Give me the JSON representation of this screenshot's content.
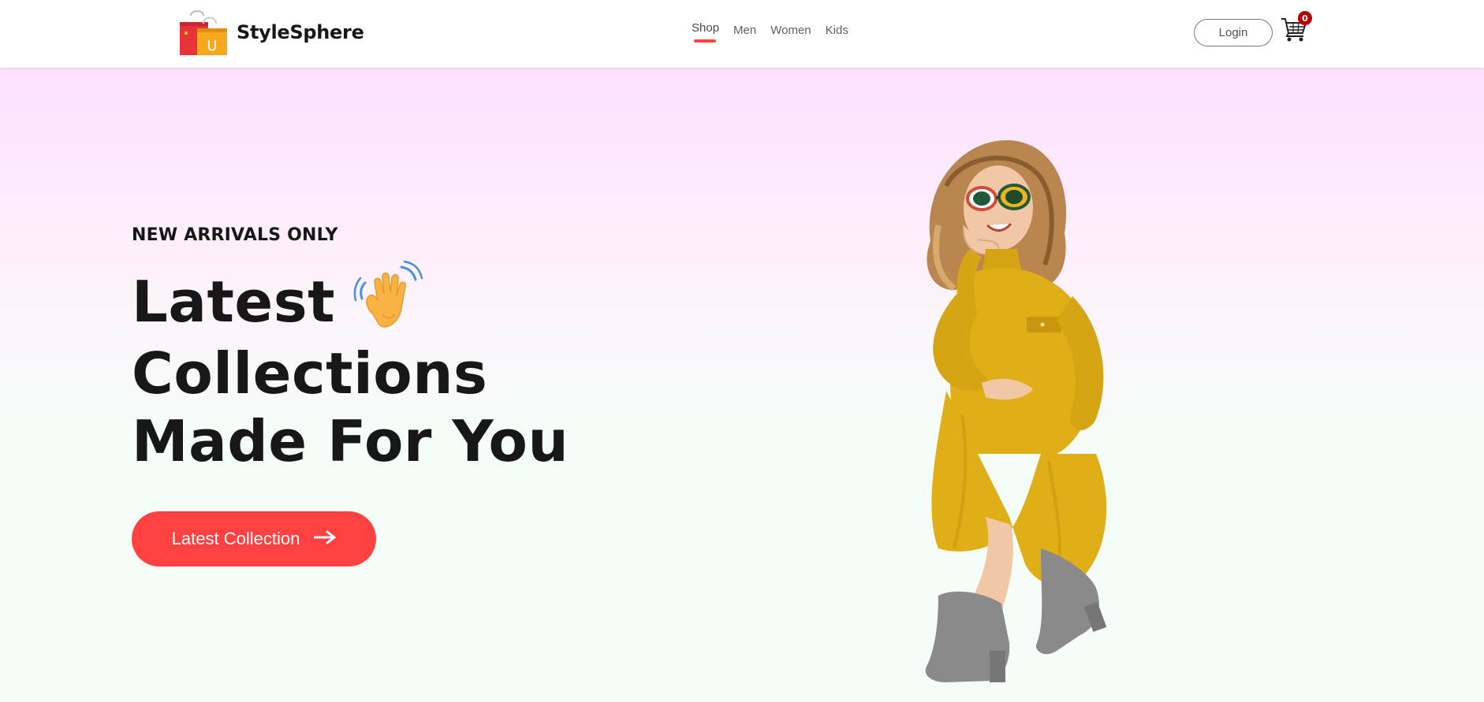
{
  "colors": {
    "accent": "#ff4141",
    "text_dark": "#171717",
    "nav_text": "#626262",
    "cart_badge": "#b80000",
    "hero_gradient_top": "#fde1ff",
    "hero_gradient_bottom": "#f6fdf9"
  },
  "navbar": {
    "brand_name": "StyleSphere",
    "logo_icon": "shopping-bag-icon",
    "menu": [
      {
        "label": "Shop",
        "active": true
      },
      {
        "label": "Men",
        "active": false
      },
      {
        "label": "Women",
        "active": false
      },
      {
        "label": "Kids",
        "active": false
      }
    ],
    "login_label": "Login",
    "cart_icon": "cart-icon",
    "cart_count": "0"
  },
  "hero": {
    "kicker": "NEW ARRIVALS ONLY",
    "headline_line1": "Latest",
    "headline_line2": "Collections",
    "headline_line3": "Made For You",
    "hero_emoji_icon": "waving-hand-icon",
    "cta_label": "Latest Collection",
    "cta_icon": "arrow-right-icon",
    "hero_image_icon": "fashion-model-image"
  }
}
